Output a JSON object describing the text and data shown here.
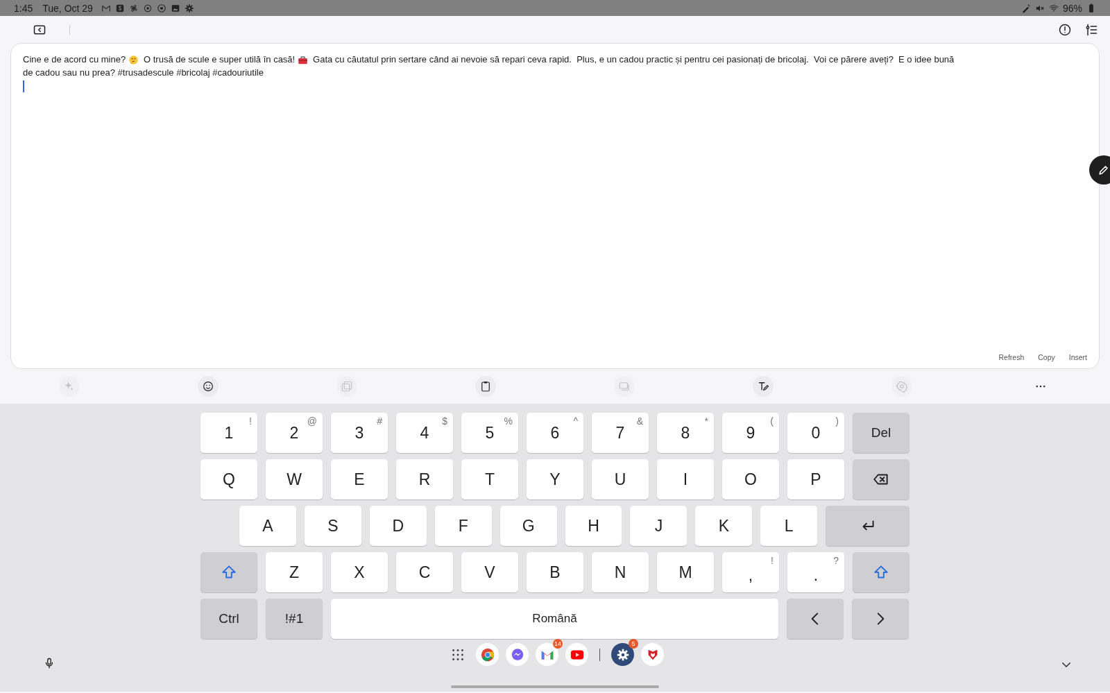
{
  "status_bar": {
    "time": "1:45",
    "date": "Tue, Oct 29",
    "battery": "96%"
  },
  "editor": {
    "lines": [
      [
        {
          "kind": "text",
          "text": "Cine e de acord cu mine? "
        },
        {
          "kind": "emoji_thinking"
        },
        {
          "kind": "text",
          "text": "  O trusă de scule e super utilă în casă! "
        },
        {
          "kind": "emoji_toolbox"
        },
        {
          "kind": "text",
          "text": "  Gata cu căutatul prin sertare când ai nevoie să repari ceva rapid.  Plus, e un cadou practic și pentru cei pasionați de bricolaj.  Voi ce părere aveți?  E o idee bună"
        }
      ],
      [
        {
          "kind": "text",
          "text": "de cadou sau nu prea? #trusadescule #bricolaj #cadouriutile"
        }
      ]
    ],
    "actions": [
      "Refresh",
      "Copy",
      "Insert"
    ]
  },
  "keyboard_toolbar": [
    {
      "kind": "sparkle",
      "disabled": true
    },
    {
      "kind": "emoji",
      "disabled": false
    },
    {
      "kind": "sticker",
      "disabled": true
    },
    {
      "kind": "clipboard",
      "disabled": false
    },
    {
      "kind": "modes",
      "disabled": true
    },
    {
      "kind": "handwriting",
      "disabled": false
    },
    {
      "kind": "settings",
      "disabled": true
    },
    {
      "kind": "more",
      "disabled": false
    }
  ],
  "keyboard": {
    "rows": [
      {
        "keys": [
          {
            "kind": "char",
            "label": "1",
            "secondary": "!"
          },
          {
            "kind": "char",
            "label": "2",
            "secondary": "@"
          },
          {
            "kind": "char",
            "label": "3",
            "secondary": "#"
          },
          {
            "kind": "char",
            "label": "4",
            "secondary": "$"
          },
          {
            "kind": "char",
            "label": "5",
            "secondary": "%"
          },
          {
            "kind": "char",
            "label": "6",
            "secondary": "^"
          },
          {
            "kind": "char",
            "label": "7",
            "secondary": "&"
          },
          {
            "kind": "char",
            "label": "8",
            "secondary": "*"
          },
          {
            "kind": "char",
            "label": "9",
            "secondary": "("
          },
          {
            "kind": "char",
            "label": "0",
            "secondary": ")"
          },
          {
            "kind": "function",
            "label": "Del"
          }
        ]
      },
      {
        "keys": [
          {
            "kind": "char",
            "label": "Q"
          },
          {
            "kind": "char",
            "label": "W"
          },
          {
            "kind": "char",
            "label": "E"
          },
          {
            "kind": "char",
            "label": "R"
          },
          {
            "kind": "char",
            "label": "T"
          },
          {
            "kind": "char",
            "label": "Y"
          },
          {
            "kind": "char",
            "label": "U"
          },
          {
            "kind": "char",
            "label": "I"
          },
          {
            "kind": "char",
            "label": "O"
          },
          {
            "kind": "char",
            "label": "P"
          },
          {
            "kind": "backspace"
          }
        ]
      },
      {
        "keys": [
          {
            "kind": "char",
            "label": "A"
          },
          {
            "kind": "char",
            "label": "S"
          },
          {
            "kind": "char",
            "label": "D"
          },
          {
            "kind": "char",
            "label": "F"
          },
          {
            "kind": "char",
            "label": "G"
          },
          {
            "kind": "char",
            "label": "H"
          },
          {
            "kind": "char",
            "label": "J"
          },
          {
            "kind": "char",
            "label": "K"
          },
          {
            "kind": "char",
            "label": "L"
          },
          {
            "kind": "enter"
          }
        ]
      },
      {
        "keys": [
          {
            "kind": "shift"
          },
          {
            "kind": "char",
            "label": "Z"
          },
          {
            "kind": "char",
            "label": "X"
          },
          {
            "kind": "char",
            "label": "C"
          },
          {
            "kind": "char",
            "label": "V"
          },
          {
            "kind": "char",
            "label": "B"
          },
          {
            "kind": "char",
            "label": "N"
          },
          {
            "kind": "char",
            "label": "M"
          },
          {
            "kind": "char",
            "label": ",",
            "secondary": "!"
          },
          {
            "kind": "char",
            "label": ".",
            "secondary": "?"
          },
          {
            "kind": "shift"
          }
        ]
      },
      {
        "keys": [
          {
            "kind": "function",
            "label": "Ctrl"
          },
          {
            "kind": "function",
            "label": "!#1"
          },
          {
            "kind": "space",
            "label": "Română"
          },
          {
            "kind": "arrow_left"
          },
          {
            "kind": "arrow_right"
          }
        ]
      }
    ]
  },
  "dock": [
    {
      "kind": "apps"
    },
    {
      "kind": "chrome"
    },
    {
      "kind": "messenger"
    },
    {
      "kind": "gmail",
      "badge": "14"
    },
    {
      "kind": "youtube"
    },
    {
      "kind": "divider"
    },
    {
      "kind": "settings",
      "badge": "5"
    },
    {
      "kind": "sameday"
    }
  ]
}
